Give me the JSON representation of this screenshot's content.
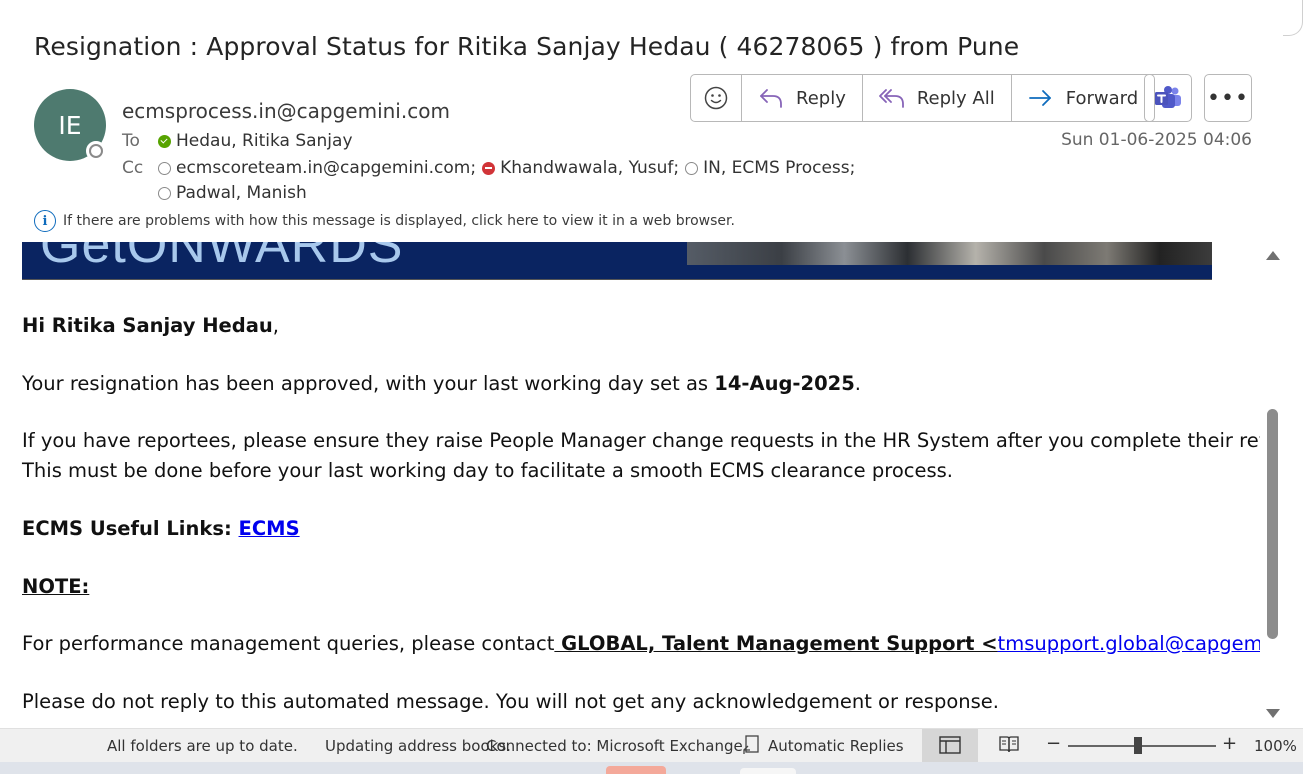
{
  "message": {
    "subject": "Resignation : Approval Status for Ritika Sanjay Hedau ( 46278065 )  from Pune",
    "avatar_initials": "IE",
    "sender": "ecmsprocess.in@capgemini.com",
    "to_label": "To",
    "cc_label": "Cc",
    "to": [
      {
        "name": "Hedau, Ritika Sanjay",
        "presence": "available"
      }
    ],
    "cc_line1": [
      {
        "name": "ecmscoreteam.in@capgemini.com;",
        "presence": "offline"
      },
      {
        "name": "Khandwawala, Yusuf;",
        "presence": "dnd"
      },
      {
        "name": "IN, ECMS Process;",
        "presence": "offline"
      }
    ],
    "cc_line2": [
      {
        "name": "Padwal, Manish",
        "presence": "offline"
      }
    ],
    "date": "Sun 01-06-2025 04:06",
    "infobar": "If there are problems with how this message is displayed, click here to view it in a web browser."
  },
  "toolbar": {
    "reply": "Reply",
    "reply_all": "Reply All",
    "forward": "Forward",
    "more": "•••"
  },
  "banner": {
    "text": "GetONWARDS"
  },
  "body": {
    "greeting_name": "Hi Ritika Sanjay Hedau",
    "greeting_comma": ",",
    "p1_pre": "Your resignation has been approved, with your last working day set as ",
    "p1_date": "14-Aug-2025",
    "p1_post": ".",
    "p2_line1": "If you have reportees, please ensure they raise People Manager change requests in the HR System after you complete their reviews.",
    "p2_line2": "This must be done before your last working day to facilitate a smooth ECMS clearance process.",
    "links_label": "ECMS Useful Links: ",
    "links_ecms": "ECMS",
    "note": "NOTE:",
    "perf_pre": "For performance management queries, please contact",
    "perf_contact": " GLOBAL, Talent Management Support <",
    "perf_email": "tmsupport.global@capgemini.com",
    "perf_close": ">",
    "no_reply": "Please do not reply to this automated message. You will not get any acknowledgement or response."
  },
  "statusbar": {
    "folders": "All folders are up to date.",
    "updating": "Updating address books.",
    "connected": "Connected to: Microsoft Exchange",
    "auto_replies": "Automatic Replies",
    "zoom": "100%",
    "zoom_level": 0.47
  },
  "colors": {
    "avatar": "#4e7a6f",
    "link": "#0000ee",
    "banner_bg": "#0a2461",
    "accent": "#0f6cbd"
  }
}
